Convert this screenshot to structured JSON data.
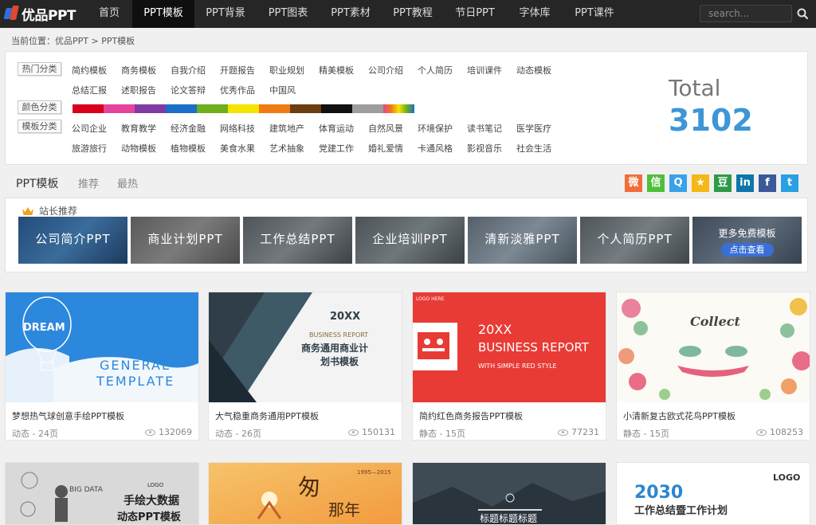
{
  "brand": {
    "logo_text": "优品PPT"
  },
  "nav": {
    "items": [
      "首页",
      "PPT模板",
      "PPT背景",
      "PPT图表",
      "PPT素材",
      "PPT教程",
      "节日PPT",
      "字体库",
      "PPT课件"
    ],
    "active": "PPT模板"
  },
  "search": {
    "placeholder": "search...",
    "icon": "search-icon"
  },
  "breadcrumb": "当前位置：优品PPT > PPT模板",
  "categories": {
    "hot_label": "热门分类",
    "hot_row1": [
      "简约模板",
      "商务模板",
      "自我介绍",
      "开题报告",
      "职业规划",
      "精美模板",
      "公司介绍",
      "个人简历",
      "培训课件",
      "动态模板"
    ],
    "hot_row2": [
      "总结汇报",
      "述职报告",
      "论文答辩",
      "优秀作品",
      "中国风"
    ],
    "color_label": "颜色分类",
    "colors": [
      "#d9001b",
      "#e4449b",
      "#7f3aa3",
      "#1a6fc8",
      "#6fae1c",
      "#f5e400",
      "#f07a13",
      "#6b3d11",
      "#111111",
      "#9d9d9d",
      "rainbow"
    ],
    "template_label": "模板分类",
    "tpl_row1": [
      "公司企业",
      "教育教学",
      "经济金融",
      "网络科技",
      "建筑地产",
      "体育运动",
      "自然风景",
      "环境保护",
      "读书笔记",
      "医学医疗"
    ],
    "tpl_row2": [
      "旅游旅行",
      "动物模板",
      "植物模板",
      "美食水果",
      "艺术抽象",
      "党建工作",
      "婚礼爱情",
      "卡通风格",
      "影视音乐",
      "社会生活"
    ]
  },
  "total": {
    "label": "Total",
    "value": "3102"
  },
  "tabs": {
    "main": "PPT模板",
    "recommend": "推荐",
    "hottest": "最热"
  },
  "share": [
    {
      "icon": "weibo-icon",
      "glyph": "微",
      "color": "#f26d3a"
    },
    {
      "icon": "wechat-icon",
      "glyph": "信",
      "color": "#4fbf3b"
    },
    {
      "icon": "qq-icon",
      "glyph": "Q",
      "color": "#3aa1e8"
    },
    {
      "icon": "qzone-icon",
      "glyph": "★",
      "color": "#f4b816"
    },
    {
      "icon": "douban-icon",
      "glyph": "豆",
      "color": "#2d9a47"
    },
    {
      "icon": "linkedin-icon",
      "glyph": "in",
      "color": "#0e76a8"
    },
    {
      "icon": "facebook-icon",
      "glyph": "f",
      "color": "#3b5998"
    },
    {
      "icon": "twitter-icon",
      "glyph": "t",
      "color": "#2a9fe3"
    }
  ],
  "featured": {
    "title": "站长推荐",
    "items": [
      "公司简介PPT",
      "商业计划PPT",
      "工作总结PPT",
      "企业培训PPT",
      "清新淡雅PPT",
      "个人简历PPT"
    ],
    "more_title": "更多免费模板",
    "more_button": "点击查看"
  },
  "cards": [
    {
      "title": "梦想热气球创意手绘PPT模板",
      "meta": "动态 - 24页",
      "views": "132069",
      "thumb_text": [
        "DREAM",
        "GENERAL",
        "TEMPLATE"
      ]
    },
    {
      "title": "大气稳重商务通用PPT模板",
      "meta": "动态 - 26页",
      "views": "150131",
      "thumb_text": [
        "20XX",
        "BUSINESS REPORT",
        "商务通用商业计",
        "划书模板"
      ]
    },
    {
      "title": "简约红色商务报告PPT模板",
      "meta": "静态 - 15页",
      "views": "77231",
      "thumb_text": [
        "LOGO HERE",
        "20XX",
        "BUSINESS REPORT",
        "WITH SIMPLE RED STYLE"
      ]
    },
    {
      "title": "小清新复古欧式花鸟PPT模板",
      "meta": "静态 - 15页",
      "views": "108253",
      "thumb_text": [
        "Collect"
      ]
    },
    {
      "thumb_text": [
        "LOGO",
        "BIG DATA",
        "手绘大数据",
        "动态PPT模板"
      ]
    },
    {
      "thumb_text": [
        "匆",
        "那年",
        "1995—2015"
      ]
    },
    {
      "thumb_text": [
        "标题标题标题"
      ]
    },
    {
      "thumb_text": [
        "LOGO",
        "2030",
        "工作总结暨工作计划"
      ]
    }
  ]
}
